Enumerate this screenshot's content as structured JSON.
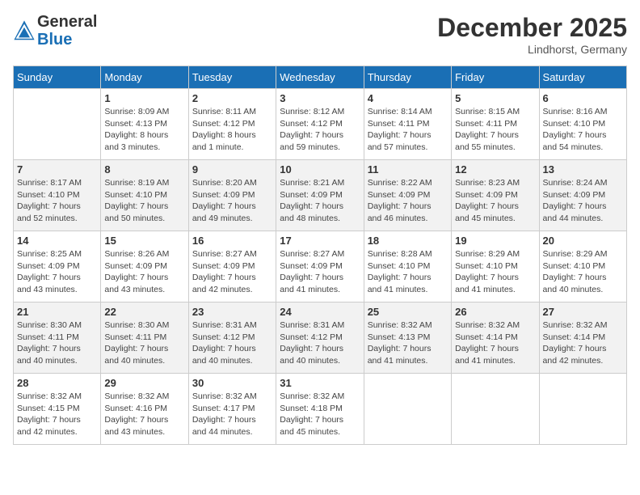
{
  "header": {
    "logo_general": "General",
    "logo_blue": "Blue",
    "month_title": "December 2025",
    "location": "Lindhorst, Germany"
  },
  "days_of_week": [
    "Sunday",
    "Monday",
    "Tuesday",
    "Wednesday",
    "Thursday",
    "Friday",
    "Saturday"
  ],
  "weeks": [
    [
      {
        "day": "",
        "info": ""
      },
      {
        "day": "1",
        "info": "Sunrise: 8:09 AM\nSunset: 4:13 PM\nDaylight: 8 hours\nand 3 minutes."
      },
      {
        "day": "2",
        "info": "Sunrise: 8:11 AM\nSunset: 4:12 PM\nDaylight: 8 hours\nand 1 minute."
      },
      {
        "day": "3",
        "info": "Sunrise: 8:12 AM\nSunset: 4:12 PM\nDaylight: 7 hours\nand 59 minutes."
      },
      {
        "day": "4",
        "info": "Sunrise: 8:14 AM\nSunset: 4:11 PM\nDaylight: 7 hours\nand 57 minutes."
      },
      {
        "day": "5",
        "info": "Sunrise: 8:15 AM\nSunset: 4:11 PM\nDaylight: 7 hours\nand 55 minutes."
      },
      {
        "day": "6",
        "info": "Sunrise: 8:16 AM\nSunset: 4:10 PM\nDaylight: 7 hours\nand 54 minutes."
      }
    ],
    [
      {
        "day": "7",
        "info": "Sunrise: 8:17 AM\nSunset: 4:10 PM\nDaylight: 7 hours\nand 52 minutes."
      },
      {
        "day": "8",
        "info": "Sunrise: 8:19 AM\nSunset: 4:10 PM\nDaylight: 7 hours\nand 50 minutes."
      },
      {
        "day": "9",
        "info": "Sunrise: 8:20 AM\nSunset: 4:09 PM\nDaylight: 7 hours\nand 49 minutes."
      },
      {
        "day": "10",
        "info": "Sunrise: 8:21 AM\nSunset: 4:09 PM\nDaylight: 7 hours\nand 48 minutes."
      },
      {
        "day": "11",
        "info": "Sunrise: 8:22 AM\nSunset: 4:09 PM\nDaylight: 7 hours\nand 46 minutes."
      },
      {
        "day": "12",
        "info": "Sunrise: 8:23 AM\nSunset: 4:09 PM\nDaylight: 7 hours\nand 45 minutes."
      },
      {
        "day": "13",
        "info": "Sunrise: 8:24 AM\nSunset: 4:09 PM\nDaylight: 7 hours\nand 44 minutes."
      }
    ],
    [
      {
        "day": "14",
        "info": "Sunrise: 8:25 AM\nSunset: 4:09 PM\nDaylight: 7 hours\nand 43 minutes."
      },
      {
        "day": "15",
        "info": "Sunrise: 8:26 AM\nSunset: 4:09 PM\nDaylight: 7 hours\nand 43 minutes."
      },
      {
        "day": "16",
        "info": "Sunrise: 8:27 AM\nSunset: 4:09 PM\nDaylight: 7 hours\nand 42 minutes."
      },
      {
        "day": "17",
        "info": "Sunrise: 8:27 AM\nSunset: 4:09 PM\nDaylight: 7 hours\nand 41 minutes."
      },
      {
        "day": "18",
        "info": "Sunrise: 8:28 AM\nSunset: 4:10 PM\nDaylight: 7 hours\nand 41 minutes."
      },
      {
        "day": "19",
        "info": "Sunrise: 8:29 AM\nSunset: 4:10 PM\nDaylight: 7 hours\nand 41 minutes."
      },
      {
        "day": "20",
        "info": "Sunrise: 8:29 AM\nSunset: 4:10 PM\nDaylight: 7 hours\nand 40 minutes."
      }
    ],
    [
      {
        "day": "21",
        "info": "Sunrise: 8:30 AM\nSunset: 4:11 PM\nDaylight: 7 hours\nand 40 minutes."
      },
      {
        "day": "22",
        "info": "Sunrise: 8:30 AM\nSunset: 4:11 PM\nDaylight: 7 hours\nand 40 minutes."
      },
      {
        "day": "23",
        "info": "Sunrise: 8:31 AM\nSunset: 4:12 PM\nDaylight: 7 hours\nand 40 minutes."
      },
      {
        "day": "24",
        "info": "Sunrise: 8:31 AM\nSunset: 4:12 PM\nDaylight: 7 hours\nand 40 minutes."
      },
      {
        "day": "25",
        "info": "Sunrise: 8:32 AM\nSunset: 4:13 PM\nDaylight: 7 hours\nand 41 minutes."
      },
      {
        "day": "26",
        "info": "Sunrise: 8:32 AM\nSunset: 4:14 PM\nDaylight: 7 hours\nand 41 minutes."
      },
      {
        "day": "27",
        "info": "Sunrise: 8:32 AM\nSunset: 4:14 PM\nDaylight: 7 hours\nand 42 minutes."
      }
    ],
    [
      {
        "day": "28",
        "info": "Sunrise: 8:32 AM\nSunset: 4:15 PM\nDaylight: 7 hours\nand 42 minutes."
      },
      {
        "day": "29",
        "info": "Sunrise: 8:32 AM\nSunset: 4:16 PM\nDaylight: 7 hours\nand 43 minutes."
      },
      {
        "day": "30",
        "info": "Sunrise: 8:32 AM\nSunset: 4:17 PM\nDaylight: 7 hours\nand 44 minutes."
      },
      {
        "day": "31",
        "info": "Sunrise: 8:32 AM\nSunset: 4:18 PM\nDaylight: 7 hours\nand 45 minutes."
      },
      {
        "day": "",
        "info": ""
      },
      {
        "day": "",
        "info": ""
      },
      {
        "day": "",
        "info": ""
      }
    ]
  ]
}
